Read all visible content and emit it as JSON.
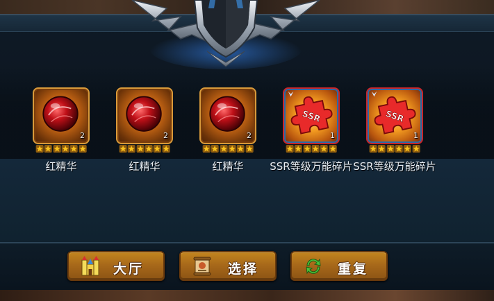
{
  "items": [
    {
      "name": "红精华",
      "count": "2",
      "type": "orb",
      "stars": 6
    },
    {
      "name": "红精华",
      "count": "2",
      "type": "orb",
      "stars": 6
    },
    {
      "name": "红精华",
      "count": "2",
      "type": "orb",
      "stars": 6
    },
    {
      "name": "SSR等级万能碎片",
      "count": "1",
      "type": "ssr-puzzle",
      "stars": 6
    },
    {
      "name": "SSR等级万能碎片",
      "count": "1",
      "type": "ssr-puzzle",
      "stars": 6
    }
  ],
  "puzzle_text": "SSR",
  "buttons": {
    "lobby": {
      "label": "大厅",
      "icon": "castle-icon"
    },
    "select": {
      "label": "选择",
      "icon": "scroll-icon"
    },
    "repeat": {
      "label": "重复",
      "icon": "refresh-icon"
    }
  },
  "colors": {
    "button_gold": "#a8691a",
    "orb_frame": "#d99a3a",
    "ssr_frame": "#c8262a",
    "star": "#f7c21f"
  }
}
